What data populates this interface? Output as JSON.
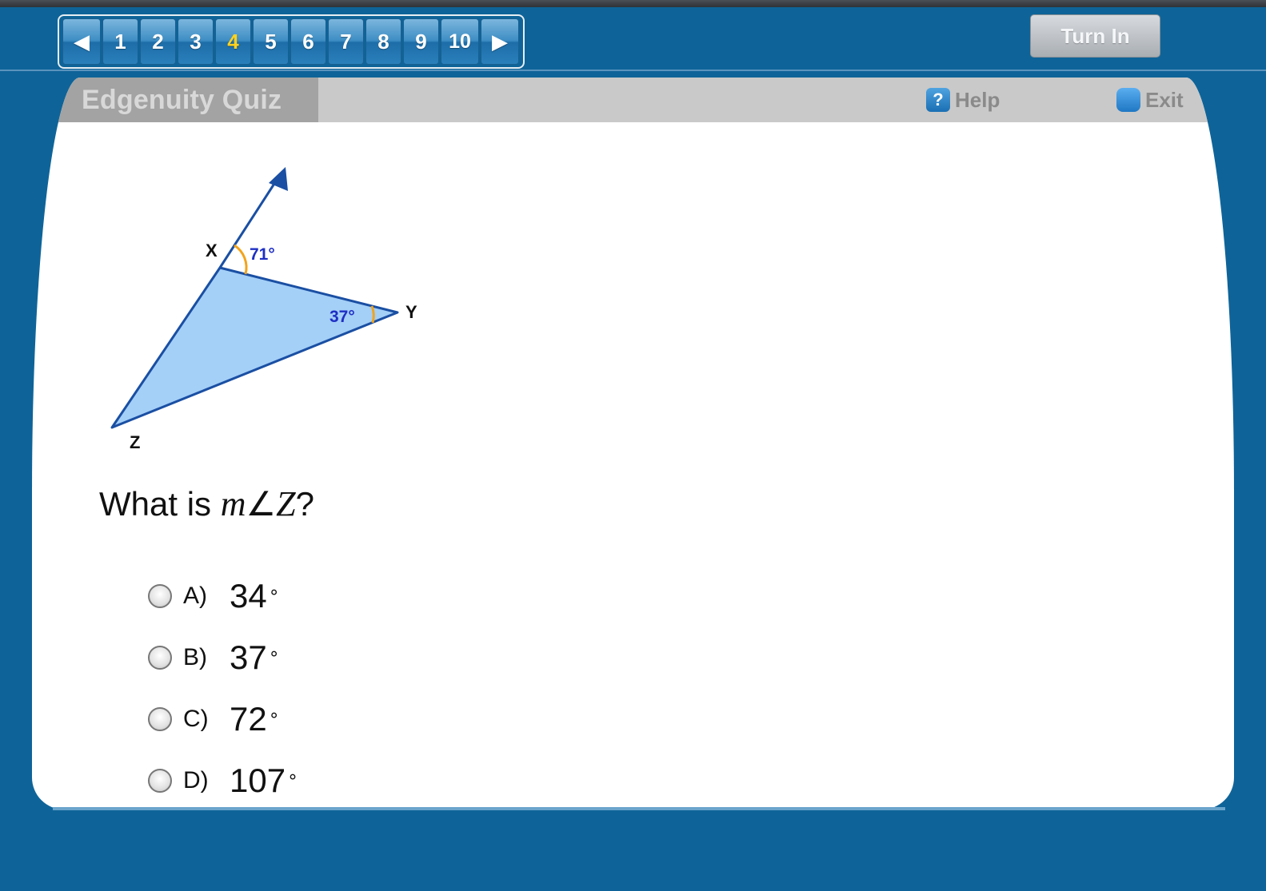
{
  "nav": {
    "prev_arrow": "◀",
    "next_arrow": "▶",
    "questions": [
      "1",
      "2",
      "3",
      "4",
      "5",
      "6",
      "7",
      "8",
      "9",
      "10"
    ],
    "current": "4",
    "current_color": "#ffd21f"
  },
  "toolbar": {
    "turn_in_label": "Turn In"
  },
  "panel": {
    "title": "Edgenuity Quiz",
    "help_label": "Help",
    "help_icon_glyph": "?",
    "exit_label": "Exit"
  },
  "figure": {
    "vertex_x": "X",
    "vertex_y": "Y",
    "vertex_z": "Z",
    "exterior_angle_x": "71°",
    "angle_y": "37°",
    "fill_color": "#a4cff7",
    "stroke_color": "#1a4fa3",
    "arc_color": "#f2a31b",
    "angle_label_color": "#1e2fc4"
  },
  "question": {
    "prefix": "What is ",
    "m": "m",
    "angle_symbol": "∠",
    "z": "Z",
    "suffix": "?"
  },
  "choices": [
    {
      "letter": "A)",
      "value": "34",
      "unit": "∘"
    },
    {
      "letter": "B)",
      "value": "37",
      "unit": "∘"
    },
    {
      "letter": "C)",
      "value": "72",
      "unit": "∘"
    },
    {
      "letter": "D)",
      "value": "107",
      "unit": "∘"
    }
  ]
}
